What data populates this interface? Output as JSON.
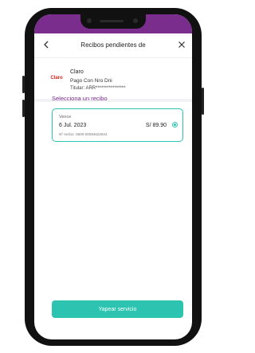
{
  "header": {
    "title": "Recibos pendientes de"
  },
  "provider": {
    "logo_text": "Claro",
    "name": "Claro",
    "service": "Pago Con Nro Dni",
    "holder": "Titular: ARR****************"
  },
  "section": {
    "title": "Selecciona un recibo"
  },
  "receipts": [
    {
      "due_label": "Vence",
      "due_date": "6 Jul. 2023",
      "amount": "S/ 89.90",
      "number": "Nº recibo: S800-00094622944",
      "selected": true
    }
  ],
  "actions": {
    "pay_label": "Yapear servicio"
  },
  "colors": {
    "brand_purple": "#7b2d8e",
    "accent_teal": "#2cc4b0",
    "claro_red": "#d6231b"
  }
}
